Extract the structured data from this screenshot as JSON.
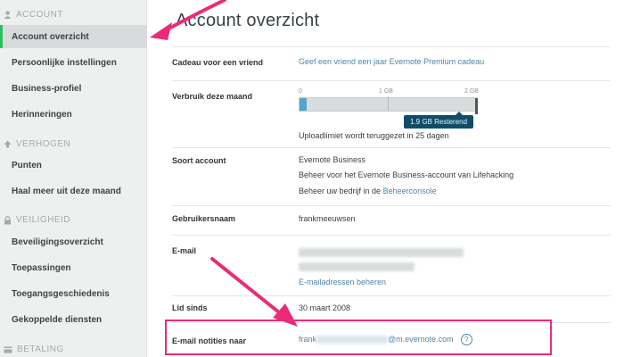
{
  "sidebar": {
    "sections": [
      {
        "title": "ACCOUNT",
        "icon": "user-icon",
        "items": [
          {
            "label": "Account overzicht",
            "active": true
          },
          {
            "label": "Persoonlijke instellingen"
          },
          {
            "label": "Business-profiel"
          },
          {
            "label": "Herinneringen"
          }
        ]
      },
      {
        "title": "VERHOGEN",
        "icon": "upgrade-arrow-icon",
        "items": [
          {
            "label": "Punten"
          },
          {
            "label": "Haal meer uit deze maand"
          }
        ]
      },
      {
        "title": "VEILIGHEID",
        "icon": "lock-icon",
        "items": [
          {
            "label": "Beveiligingsoverzicht"
          },
          {
            "label": "Toepassingen"
          },
          {
            "label": "Toegangsgeschiedenis"
          },
          {
            "label": "Gekoppelde diensten"
          }
        ]
      },
      {
        "title": "BETALING",
        "icon": "card-icon",
        "items": []
      }
    ]
  },
  "main": {
    "title": "Account overzicht",
    "gift": {
      "label": "Cadeau voor een vriend",
      "link": "Geef een vriend een jaar Evernote Premium cadeau"
    },
    "usage": {
      "label": "Verbruik deze maand",
      "ticks": [
        "0",
        "1 GB",
        "2 GB"
      ],
      "used_fraction": 0.04,
      "remaining": "1.9 GB Resterend",
      "note": "Uploadlimiet wordt teruggezet in 25 dagen"
    },
    "account_type": {
      "label": "Soort account",
      "lines": [
        "Evernote Business",
        "Beheer voor het Evernote Business-account van Lifehacking"
      ],
      "manage_prefix": "Beheer uw bedrijf in de ",
      "manage_link": "Beheerconsole"
    },
    "username": {
      "label": "Gebruikersnaam",
      "value": "frankmeeuwsen"
    },
    "email": {
      "label": "E-mail",
      "link": "E-mailadressen beheren"
    },
    "member_since": {
      "label": "Lid sinds",
      "value": "30 maart 2008"
    },
    "email_notes": {
      "label": "E-mail notities naar",
      "value_prefix": "frank",
      "value_suffix": "@m.evernote.com",
      "help": "?"
    }
  },
  "colors": {
    "annotation": "#ec2a78",
    "link": "#4d86a8",
    "accent": "#2dbe60"
  }
}
